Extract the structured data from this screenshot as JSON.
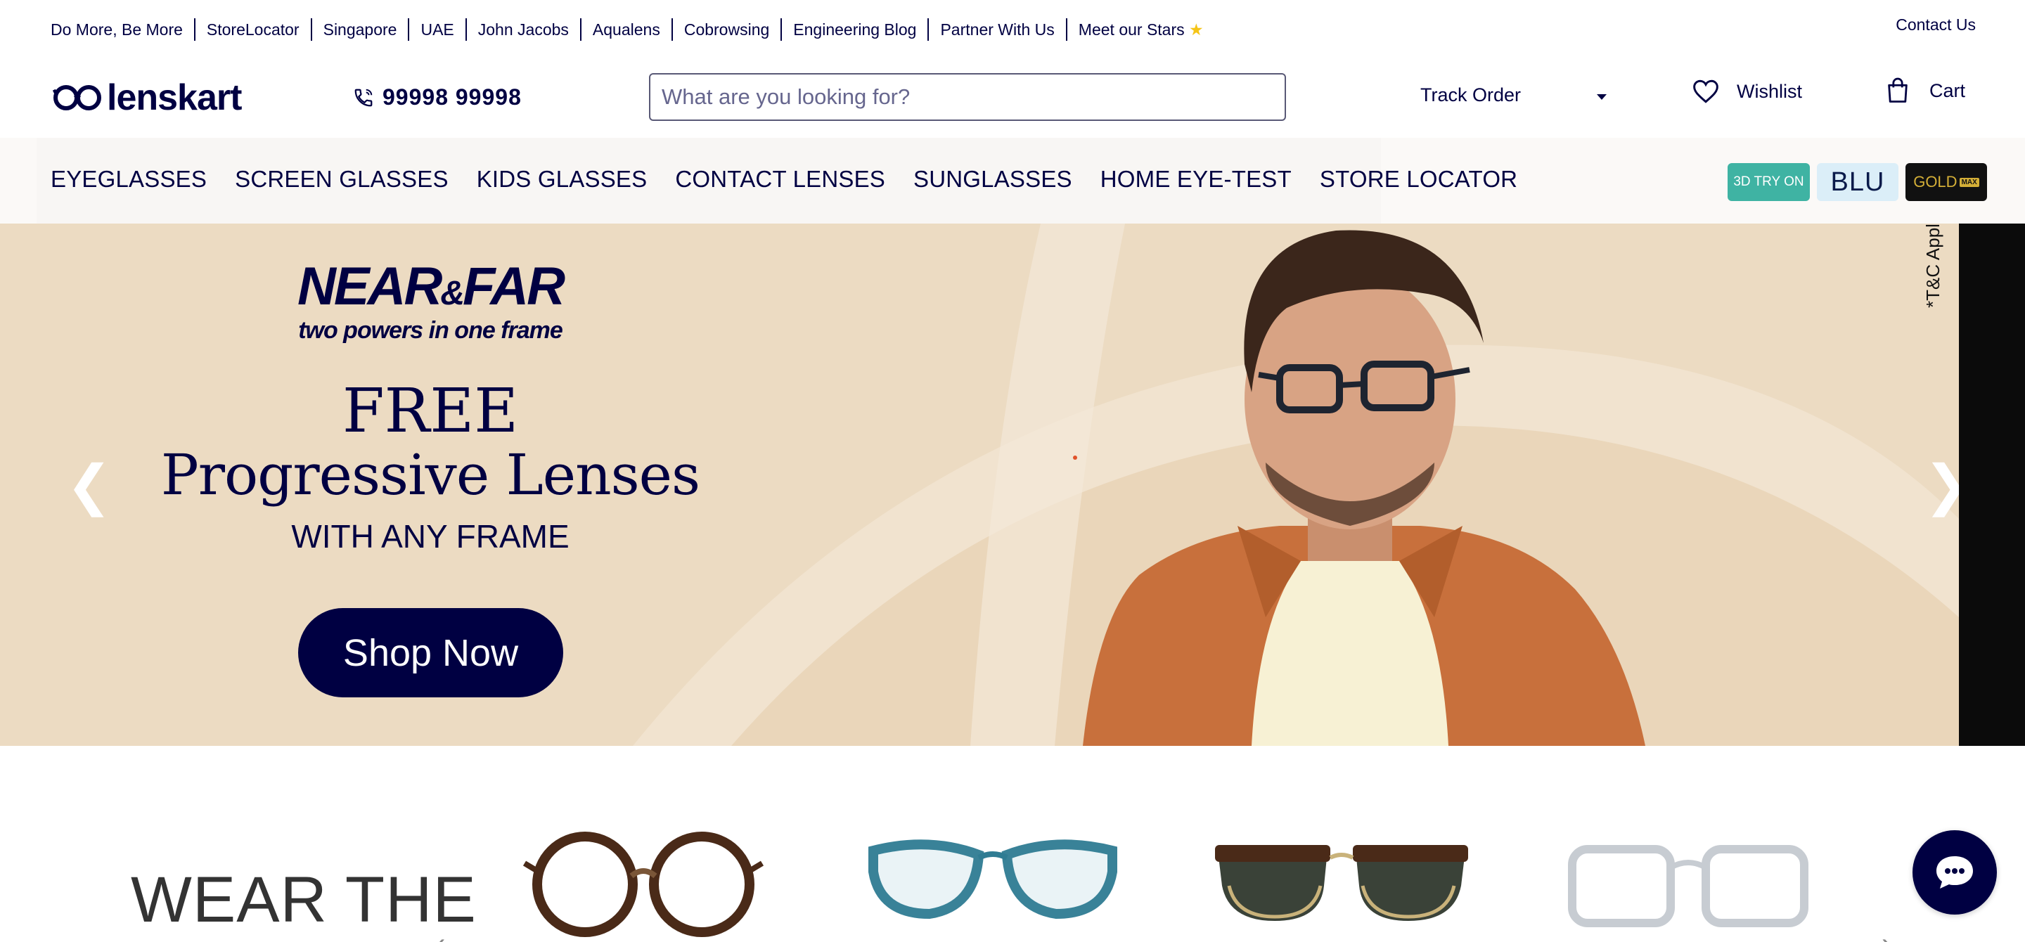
{
  "topbar": {
    "links": [
      "Do More, Be More",
      "StoreLocator",
      "Singapore",
      "UAE",
      "John Jacobs",
      "Aqualens",
      "Cobrowsing",
      "Engineering Blog",
      "Partner With Us",
      "Meet our Stars"
    ],
    "contact": "Contact Us"
  },
  "header": {
    "logo_text": "lenskart",
    "phone": "99998 99998",
    "search_placeholder": "What are you looking for?",
    "track_order": "Track Order",
    "wishlist": "Wishlist",
    "cart": "Cart"
  },
  "nav": {
    "items": [
      "EYEGLASSES",
      "SCREEN GLASSES",
      "KIDS GLASSES",
      "CONTACT LENSES",
      "SUNGLASSES",
      "HOME EYE-TEST",
      "STORE LOCATOR"
    ],
    "badges": {
      "try_on": "3D TRY ON",
      "blu": "BLU",
      "gold": "GOLD",
      "gold_max": "MAX"
    }
  },
  "hero": {
    "brand_title_near": "NEAR",
    "brand_title_amp": "&",
    "brand_title_far": "FAR",
    "brand_subtitle": "two powers in one frame",
    "headline_1": "FREE",
    "headline_2": "Progressive Lenses",
    "headline_3": "WITH ANY FRAME",
    "cta": "Shop Now",
    "terms": "*T&C Appl",
    "prev_arrow": "❮",
    "next_arrow": "❯"
  },
  "section": {
    "heading": "WEAR THE"
  },
  "colors": {
    "brand_navy": "#000042",
    "hero_bg": "#ecdbc2",
    "try_on_teal": "#3fb3a3"
  }
}
